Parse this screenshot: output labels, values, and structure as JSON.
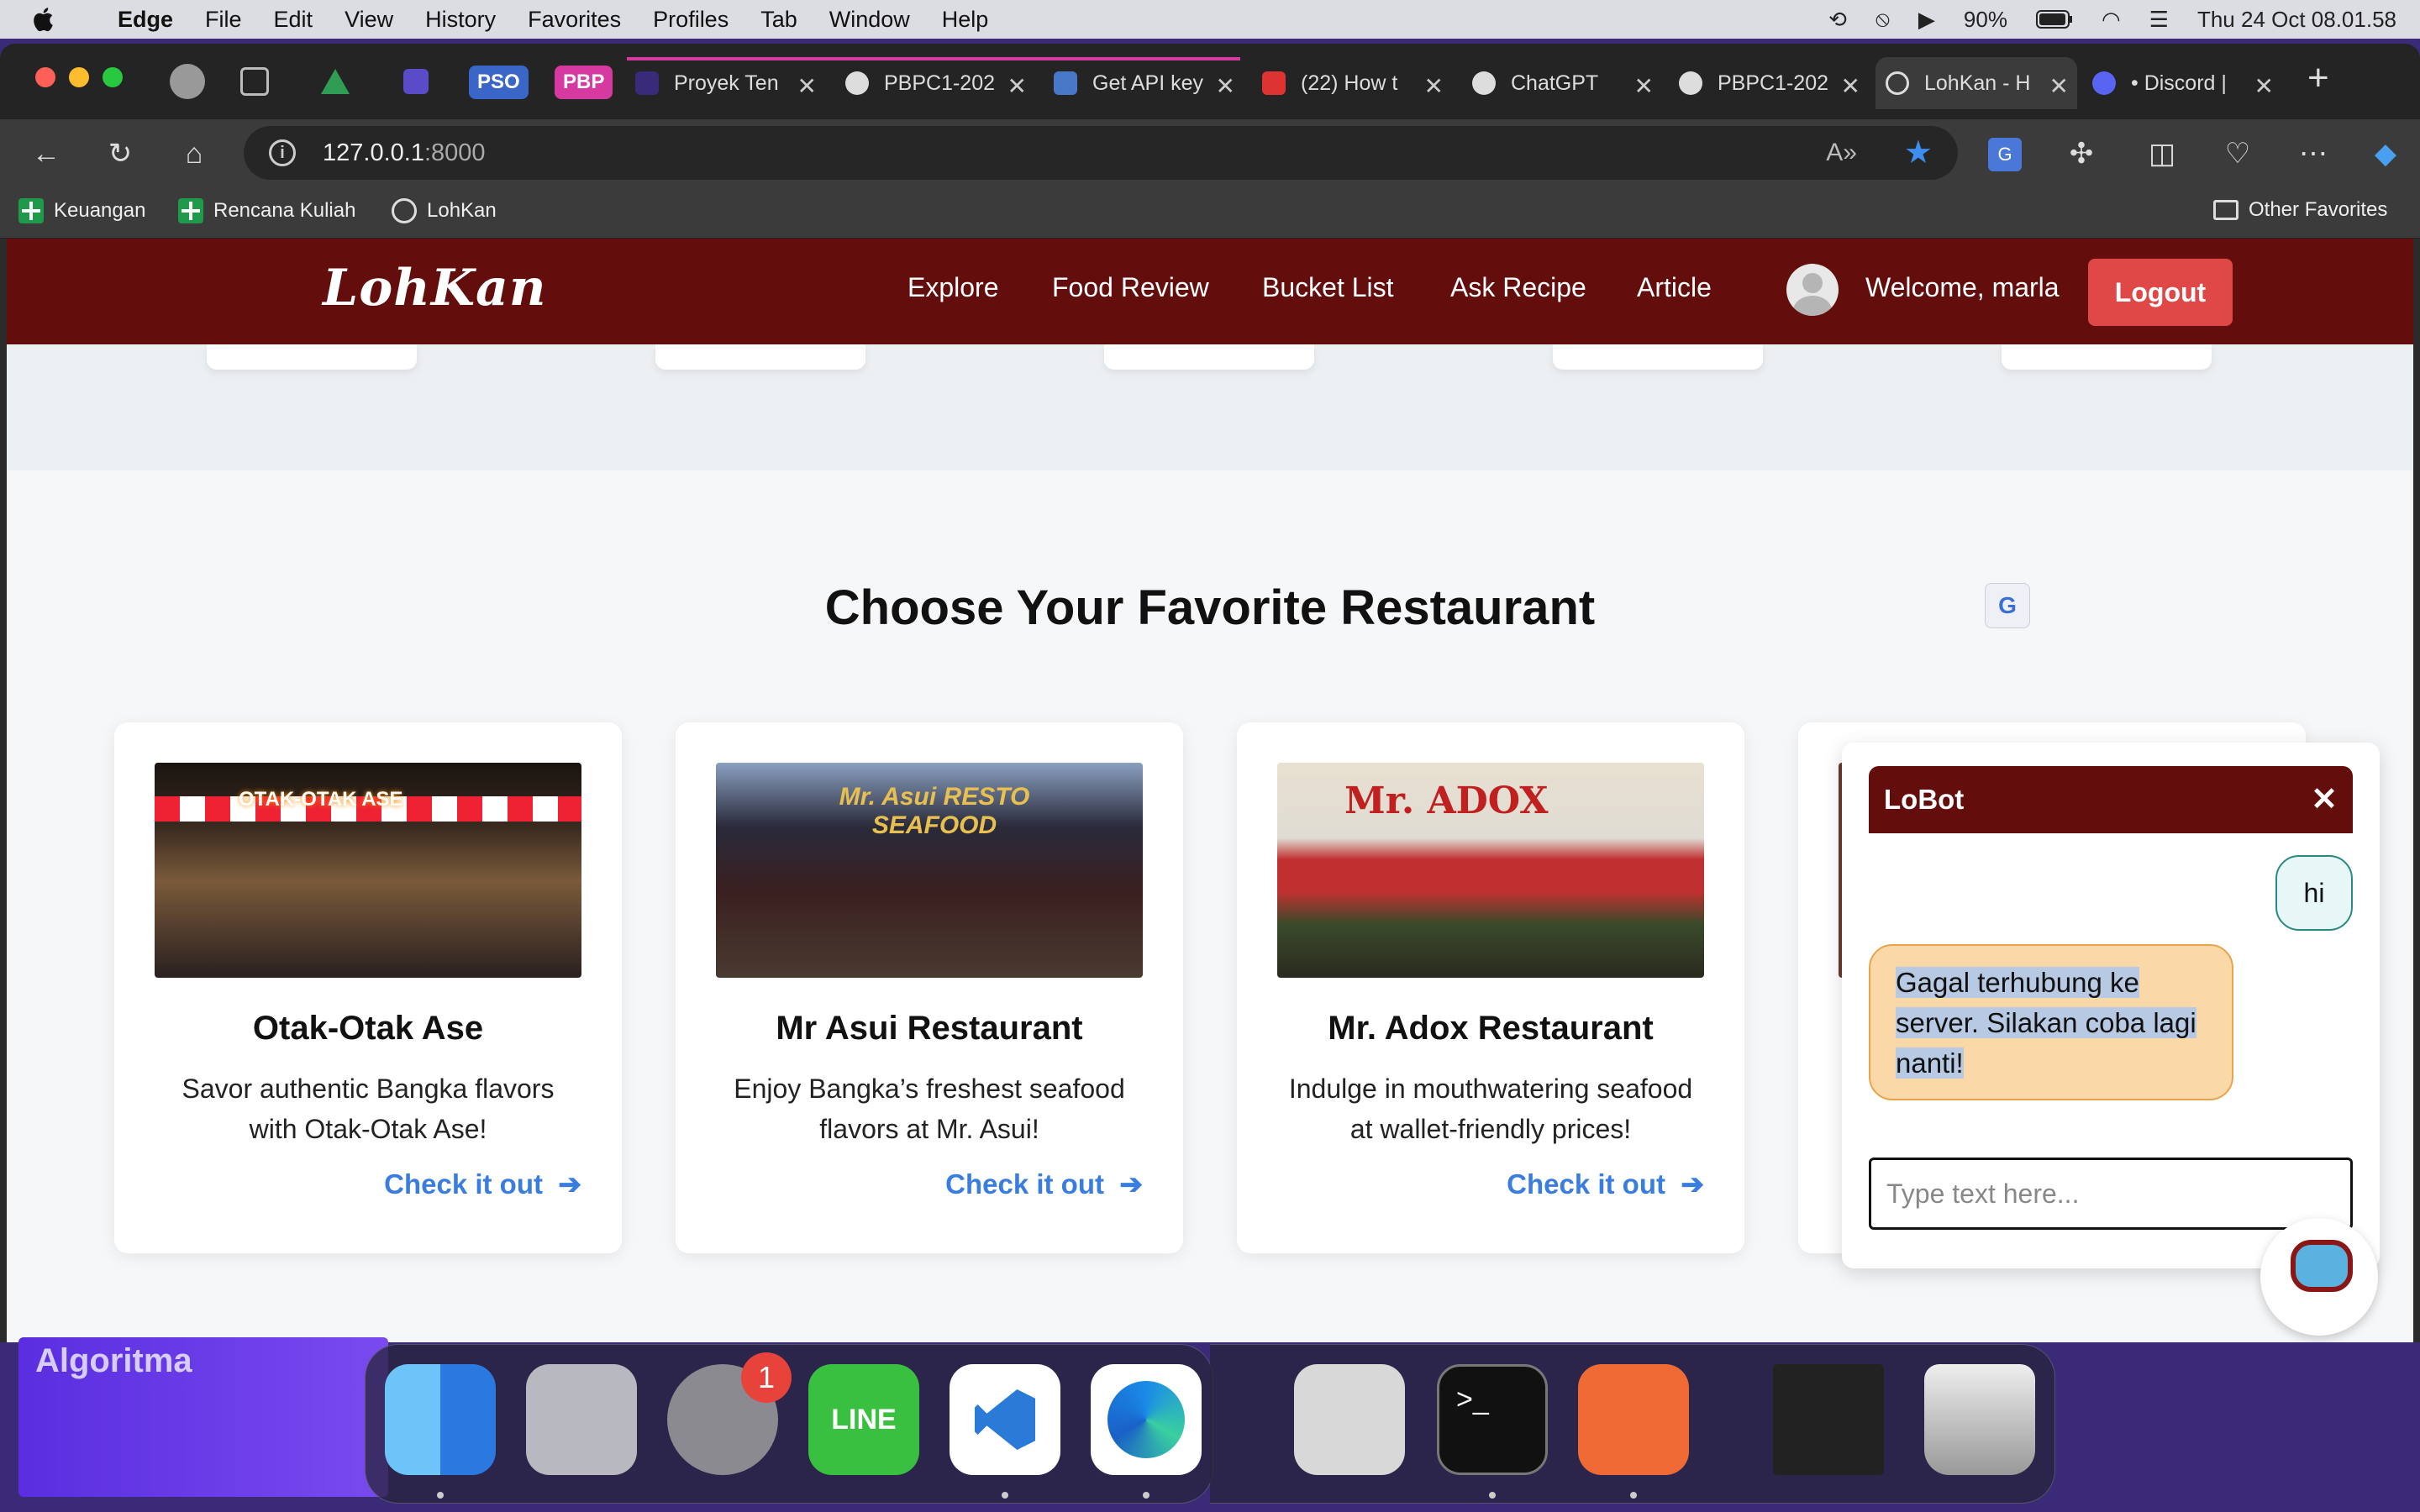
{
  "menubar": {
    "app_name": "Edge",
    "items": [
      "File",
      "Edit",
      "View",
      "History",
      "Favorites",
      "Profiles",
      "Tab",
      "Window",
      "Help"
    ],
    "battery": "90%",
    "datetime": "Thu 24 Oct  08.01.58"
  },
  "tabs": {
    "pinned": [
      "PSO",
      "PBP"
    ],
    "items": [
      {
        "label": "Proyek Ten"
      },
      {
        "label": "PBPC1-202"
      },
      {
        "label": "Get API key"
      },
      {
        "label": "(22) How t"
      },
      {
        "label": "ChatGPT"
      },
      {
        "label": "PBPC1-202"
      },
      {
        "label": "LohKan - H"
      },
      {
        "label": "• Discord |"
      }
    ],
    "new_tab_icon": "+"
  },
  "address": {
    "host": "127.0.0.1",
    "port": ":8000"
  },
  "bookmarks": {
    "items": [
      "Keuangan",
      "Rencana Kuliah",
      "LohKan"
    ],
    "other": "Other Favorites"
  },
  "site": {
    "logo": "LohKan",
    "nav": [
      "Explore",
      "Food Review",
      "Bucket List",
      "Ask Recipe",
      "Article"
    ],
    "welcome": "Welcome, marla",
    "logout": "Logout"
  },
  "main": {
    "heading": "Choose Your Favorite Restaurant",
    "cards": [
      {
        "image_text": "OTAK-OTAK ASE",
        "title": "Otak-Otak Ase",
        "desc": "Savor authentic Bangka flavors with Otak-Otak Ase!",
        "cta": "Check it out"
      },
      {
        "image_text": "Mr. Asui RESTO SEAFOOD",
        "title": "Mr Asui Restaurant",
        "desc": "Enjoy Bangka’s freshest seafood flavors at Mr. Asui!",
        "cta": "Check it out"
      },
      {
        "image_text": "Mr. ADOX",
        "title": "Mr. Adox Restaurant",
        "desc": "Indulge in mouthwatering seafood at wallet-friendly prices!",
        "cta": "Check it out"
      }
    ]
  },
  "chat": {
    "title": "LoBot",
    "close": "✕",
    "user_message": "hi",
    "bot_message": "Gagal terhubung ke server. Silakan coba lagi nanti!",
    "input_placeholder": "Type text here..."
  },
  "desktop": {
    "label": "Algoritma"
  },
  "dock": {
    "badge": "1",
    "line_label": "LINE"
  },
  "colors": {
    "brand_dark_red": "#640d0d",
    "logout_red": "#e04848",
    "link_blue": "#3a7de0",
    "bot_bubble": "#fbd8a8"
  }
}
